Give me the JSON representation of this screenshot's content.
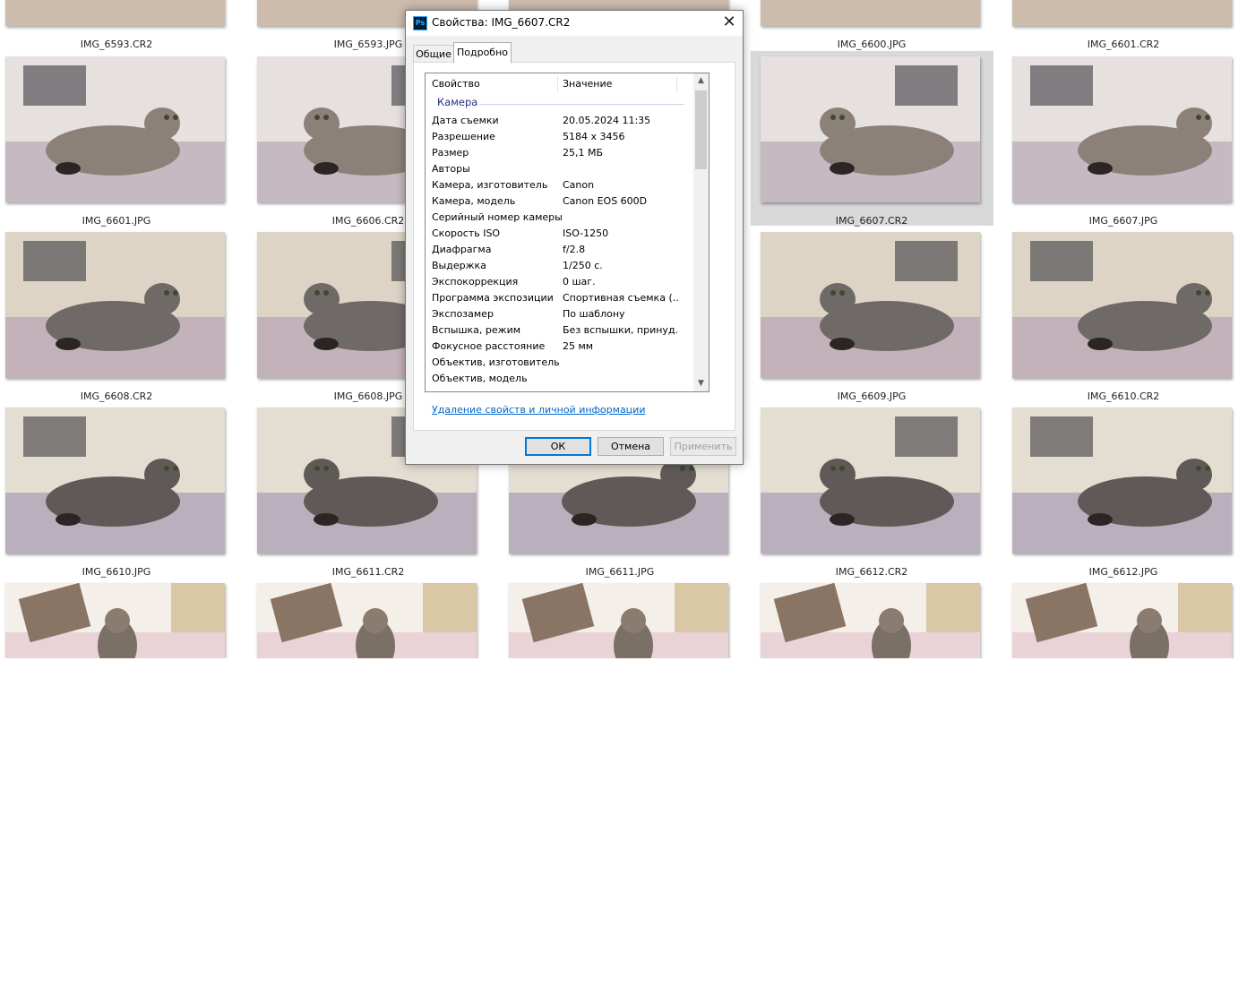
{
  "grid": {
    "rows": [
      [
        "IMG_6593.CR2",
        "IMG_6593.JPG",
        "",
        "IMG_6600.JPG",
        "IMG_6601.CR2"
      ],
      [
        "IMG_6601.JPG",
        "IMG_6606.CR2",
        "",
        "IMG_6607.CR2",
        "IMG_6607.JPG"
      ],
      [
        "IMG_6608.CR2",
        "IMG_6608.JPG",
        "",
        "IMG_6609.JPG",
        "IMG_6610.CR2"
      ],
      [
        "IMG_6610.JPG",
        "IMG_6611.CR2",
        "IMG_6611.JPG",
        "IMG_6612.CR2",
        "IMG_6612.JPG"
      ],
      [
        "",
        "",
        "",
        "",
        ""
      ]
    ],
    "selected": "IMG_6607.CR2"
  },
  "dialog": {
    "app_icon": "Ps",
    "title": "Свойства: IMG_6607.CR2",
    "close_glyph": "✕",
    "tabs": [
      {
        "label": "Общие",
        "active": false
      },
      {
        "label": "Подробно",
        "active": true
      }
    ],
    "columns": {
      "property": "Свойство",
      "value": "Значение"
    },
    "group": "Камера",
    "properties": [
      {
        "name": "Дата съемки",
        "value": "20.05.2024 11:35"
      },
      {
        "name": "Разрешение",
        "value": "5184 x 3456"
      },
      {
        "name": "Размер",
        "value": "25,1 МБ"
      },
      {
        "name": "Авторы",
        "value": ""
      },
      {
        "name": "Камера, изготовитель",
        "value": "Canon"
      },
      {
        "name": "Камера, модель",
        "value": "Canon EOS 600D"
      },
      {
        "name": "Серийный номер камеры",
        "value": ""
      },
      {
        "name": "Скорость ISO",
        "value": "ISO-1250"
      },
      {
        "name": "Диафрагма",
        "value": "f/2.8"
      },
      {
        "name": "Выдержка",
        "value": "1/250 с."
      },
      {
        "name": "Экспокоррекция",
        "value": "0 шаг."
      },
      {
        "name": "Программа экспозиции",
        "value": "Спортивная съемка (..."
      },
      {
        "name": "Экспозамер",
        "value": "По шаблону"
      },
      {
        "name": "Вспышка, режим",
        "value": "Без вспышки, принуд..."
      },
      {
        "name": "Фокусное расстояние",
        "value": "25 мм"
      },
      {
        "name": "Объектив, изготовитель",
        "value": ""
      },
      {
        "name": "Объектив, модель",
        "value": ""
      }
    ],
    "scroll_up_glyph": "▲",
    "scroll_down_glyph": "▼",
    "remove_link": "Удаление свойств и личной информации",
    "buttons": {
      "ok": "ОК",
      "cancel": "Отмена",
      "apply": "Применить"
    }
  },
  "icons": {
    "app": "photoshop-icon",
    "close": "close-icon"
  }
}
